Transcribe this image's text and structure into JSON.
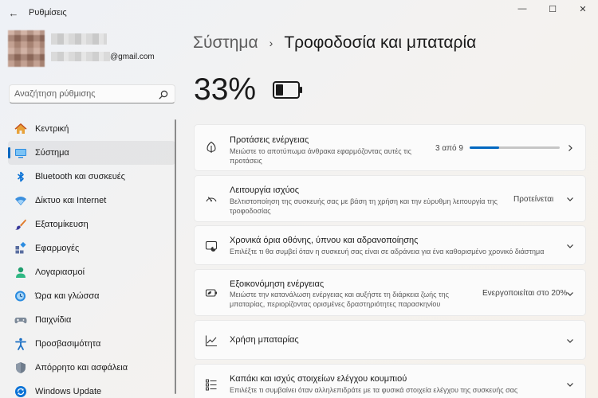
{
  "window": {
    "title": "Ρυθμίσεις",
    "back_glyph": "←",
    "minimize_glyph": "—",
    "maximize_glyph": "☐",
    "close_glyph": "✕"
  },
  "user": {
    "email_suffix": "@gmail.com"
  },
  "search": {
    "placeholder": "Αναζήτηση ρύθμισης"
  },
  "sidebar": {
    "items": [
      {
        "label": "Κεντρική",
        "icon": "home-icon"
      },
      {
        "label": "Σύστημα",
        "icon": "system-icon",
        "active": true
      },
      {
        "label": "Bluetooth και συσκευές",
        "icon": "bluetooth-icon"
      },
      {
        "label": "Δίκτυο και Internet",
        "icon": "wifi-icon"
      },
      {
        "label": "Εξατομίκευση",
        "icon": "brush-icon"
      },
      {
        "label": "Εφαρμογές",
        "icon": "apps-icon"
      },
      {
        "label": "Λογαριασμοί",
        "icon": "person-icon"
      },
      {
        "label": "Ώρα και γλώσσα",
        "icon": "globe-clock-icon"
      },
      {
        "label": "Παιχνίδια",
        "icon": "gamepad-icon"
      },
      {
        "label": "Προσβασιμότητα",
        "icon": "accessibility-icon"
      },
      {
        "label": "Απόρρητο και ασφάλεια",
        "icon": "shield-icon"
      },
      {
        "label": "Windows Update",
        "icon": "update-icon"
      }
    ]
  },
  "header": {
    "parent": "Σύστημα",
    "separator": "›",
    "current": "Τροφοδοσία και μπαταρία"
  },
  "battery": {
    "percent": "33%",
    "level": 0.33
  },
  "cards": {
    "recommendations": {
      "title": "Προτάσεις ενέργειας",
      "desc": "Μειώστε το αποτύπωμα άνθρακα εφαρμόζοντας αυτές τις προτάσεις",
      "status": "3 από 9",
      "progress": 0.33
    },
    "power_mode": {
      "title": "Λειτουργία ισχύος",
      "desc": "Βελτιστοποίηση της συσκευής σας με βάση τη χρήση και την εύρυθμη λειτουργία της τροφοδοσίας",
      "status": "Προτείνεται"
    },
    "screen_sleep": {
      "title": "Χρονικά όρια οθόνης, ύπνου και αδρανοποίησης",
      "desc": "Επιλέξτε τι θα συμβεί όταν η συσκευή σας είναι σε αδράνεια για ένα καθορισμένο χρονικό διάστημα"
    },
    "energy_saver": {
      "title": "Εξοικονόμηση ενέργειας",
      "desc": "Μειώστε την κατανάλωση ενέργειας και αυξήστε τη διάρκεια ζωής της μπαταρίας, περιορίζοντας ορισμένες δραστηριότητες παρασκηνίου",
      "status": "Ενεργοποιείται στο 20%"
    },
    "battery_usage": {
      "title": "Χρήση μπαταρίας"
    },
    "lid_power": {
      "title": "Καπάκι και ισχύς στοιχείων ελέγχου κουμπιού",
      "desc": "Επιλέξτε τι συμβαίνει όταν αλληλεπιδράτε με τα φυσικά στοιχεία ελέγχου της συσκευής σας"
    }
  },
  "colors": {
    "accent": "#0067c0"
  }
}
